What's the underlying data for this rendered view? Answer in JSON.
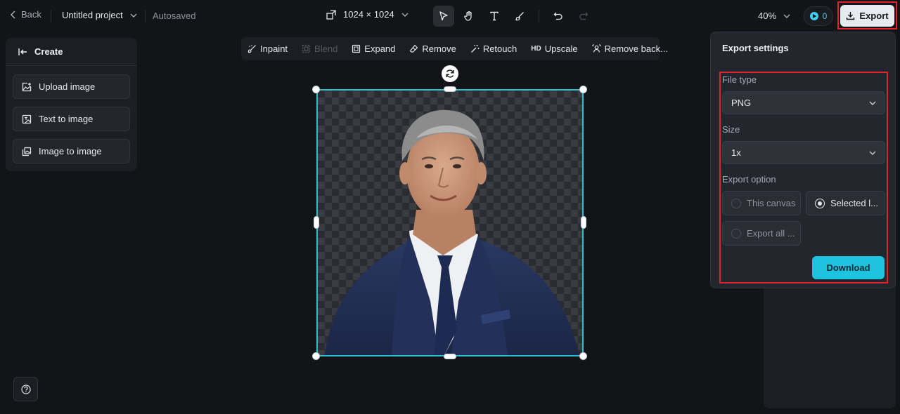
{
  "topbar": {
    "back_label": "Back",
    "project_name": "Untitled project",
    "save_status": "Autosaved",
    "canvas_size": "1024 × 1024",
    "zoom": "40%",
    "credits": "0",
    "export_label": "Export"
  },
  "create_panel": {
    "title": "Create",
    "items": [
      {
        "label": "Upload image",
        "icon": "upload-image-icon"
      },
      {
        "label": "Text to image",
        "icon": "text-to-image-icon"
      },
      {
        "label": "Image to image",
        "icon": "image-to-image-icon"
      }
    ]
  },
  "edit_toolbar": {
    "items": [
      {
        "label": "Inpaint",
        "enabled": true
      },
      {
        "label": "Blend",
        "enabled": false
      },
      {
        "label": "Expand",
        "enabled": true
      },
      {
        "label": "Remove",
        "enabled": true
      },
      {
        "label": "Retouch",
        "enabled": true
      },
      {
        "label": "Upscale",
        "prefix": "HD",
        "enabled": true
      },
      {
        "label": "Remove back...",
        "enabled": true
      }
    ]
  },
  "export_settings": {
    "title": "Export settings",
    "file_type_label": "File type",
    "file_type_value": "PNG",
    "size_label": "Size",
    "size_value": "1x",
    "export_option_label": "Export option",
    "options": [
      {
        "label": "This canvas",
        "selected": false
      },
      {
        "label": "Selected l...",
        "selected": true
      },
      {
        "label": "Export all ...",
        "selected": false
      }
    ],
    "download_label": "Download"
  },
  "colors": {
    "accent": "#1ec3df",
    "selection": "#2bc1d2",
    "highlight": "#e0242c"
  }
}
